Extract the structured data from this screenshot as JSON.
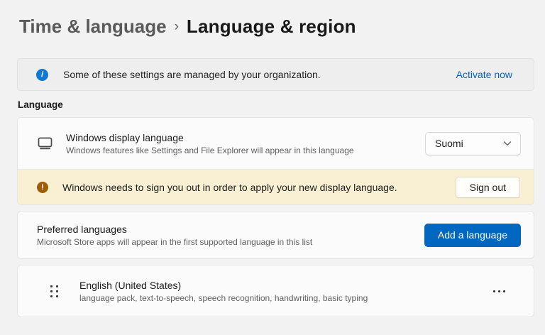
{
  "breadcrumb": {
    "parent": "Time & language",
    "separator": "›",
    "current": "Language & region"
  },
  "org_banner": {
    "icon": "info-icon",
    "icon_glyph": "i",
    "message": "Some of these settings are managed by your organization.",
    "action_label": "Activate now"
  },
  "language_section": {
    "label": "Language"
  },
  "display_language": {
    "icon": "monitor-icon",
    "title": "Windows display language",
    "description": "Windows features like Settings and File Explorer will appear in this language",
    "selected_value": "Suomi"
  },
  "signout_notice": {
    "icon": "warning-icon",
    "icon_glyph": "!",
    "message": "Windows needs to sign you out in order to apply your new display language.",
    "button_label": "Sign out"
  },
  "preferred_languages": {
    "title": "Preferred languages",
    "description": "Microsoft Store apps will appear in the first supported language in this list",
    "add_button_label": "Add a language"
  },
  "languages": [
    {
      "name": "English (United States)",
      "features": "language pack, text-to-speech, speech recognition, handwriting, basic typing"
    }
  ],
  "colors": {
    "accent": "#0067c0",
    "link": "#0a60bf",
    "info_icon": "#1179d4",
    "warning_icon": "#9d5d00",
    "warning_bg": "#f9efd2",
    "page_bg": "#f2f2f2"
  }
}
